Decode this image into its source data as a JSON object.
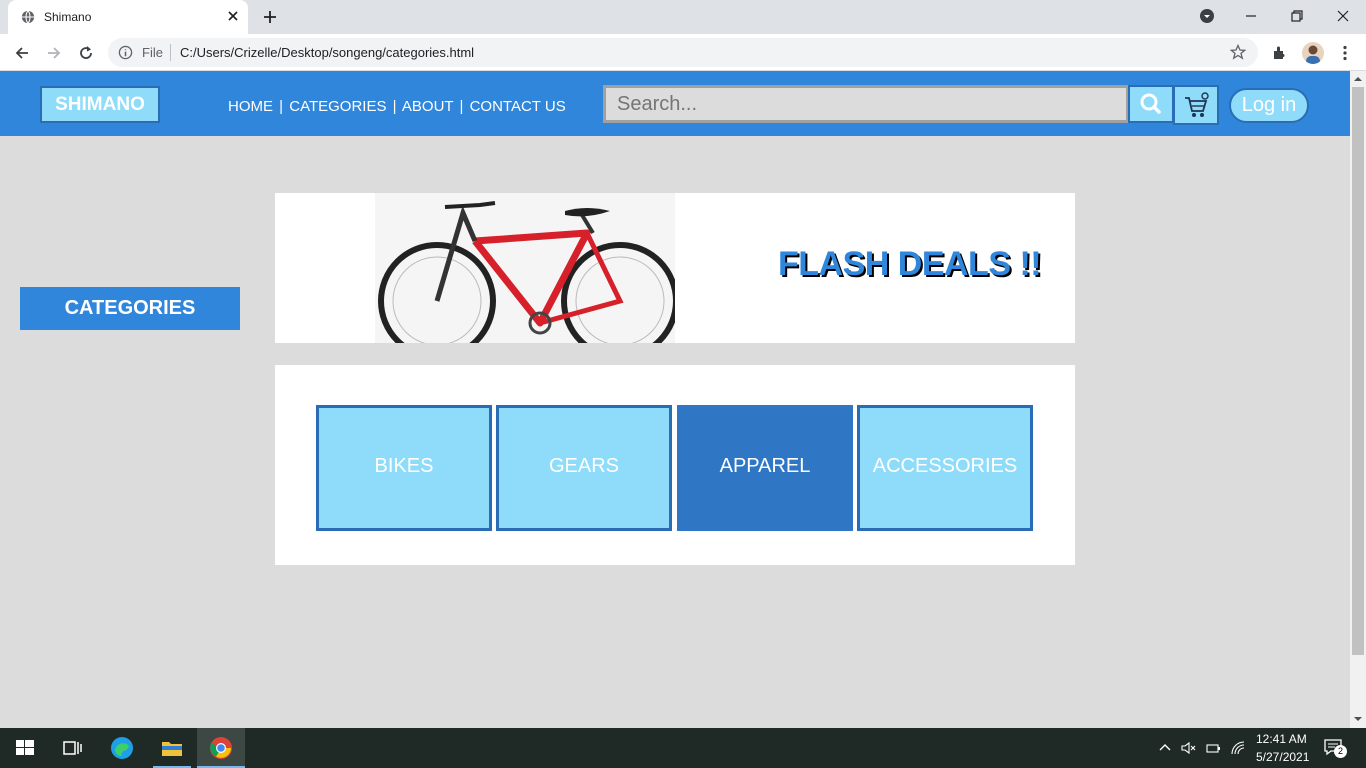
{
  "browser": {
    "tab_title": "Shimano",
    "omnibox_scheme": "File",
    "url": "C:/Users/Crizelle/Desktop/songeng/categories.html"
  },
  "site": {
    "logo": "SHIMANO",
    "nav": [
      "HOME",
      "CATEGORIES",
      "ABOUT",
      "CONTACT US"
    ],
    "nav_separator": "|",
    "search_placeholder": "Search...",
    "login": "Log in"
  },
  "sidebar": {
    "categories_label": "CATEGORIES"
  },
  "banner": {
    "text": "FLASH DEALS !!"
  },
  "categories": [
    {
      "label": "BIKES",
      "active": false
    },
    {
      "label": "GEARS",
      "active": false
    },
    {
      "label": "APPAREL",
      "active": true
    },
    {
      "label": "ACCESSORIES",
      "active": false
    }
  ],
  "colors": {
    "header_blue": "#2f86da",
    "light_blue": "#8edcfa",
    "active_blue": "#2f76c4",
    "border_blue": "#2a6db5"
  },
  "taskbar": {
    "time": "12:41 AM",
    "date": "5/27/2021",
    "notification_count": "2"
  }
}
